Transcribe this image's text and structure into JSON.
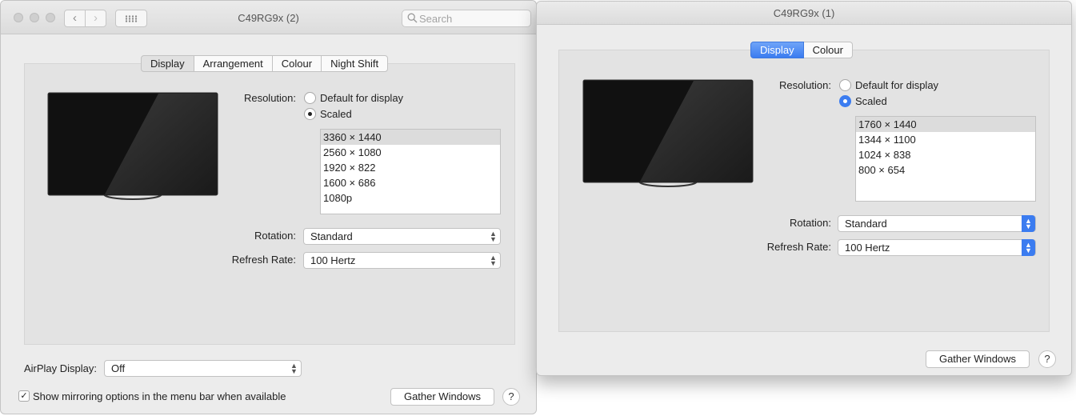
{
  "left_window": {
    "title": "C49RG9x (2)",
    "search_placeholder": "Search",
    "nav": {
      "back_glyph": "‹",
      "forward_glyph": "›"
    },
    "tabs": [
      "Display",
      "Arrangement",
      "Colour",
      "Night Shift"
    ],
    "selected_tab": "Display",
    "resolution": {
      "label": "Resolution:",
      "option_default": "Default for display",
      "option_scaled": "Scaled",
      "selected": "Scaled",
      "list": [
        "3360 × 1440",
        "2560 × 1080",
        "1920 × 822",
        "1600 × 686",
        "1080p"
      ],
      "list_selected": "3360 × 1440"
    },
    "rotation": {
      "label": "Rotation:",
      "value": "Standard"
    },
    "refresh": {
      "label": "Refresh Rate:",
      "value": "100 Hertz"
    },
    "airplay": {
      "label": "AirPlay Display:",
      "value": "Off"
    },
    "mirroring": {
      "label": "Show mirroring options in the menu bar when available",
      "checked": true,
      "check_glyph": "✓"
    },
    "gather_label": "Gather Windows",
    "help_glyph": "?"
  },
  "right_window": {
    "title": "C49RG9x (1)",
    "tabs": [
      "Display",
      "Colour"
    ],
    "selected_tab": "Display",
    "resolution": {
      "label": "Resolution:",
      "option_default": "Default for display",
      "option_scaled": "Scaled",
      "selected": "Scaled",
      "list": [
        "1760 × 1440",
        "1344 × 1100",
        "1024 × 838",
        "800 × 654"
      ],
      "list_selected": "1760 × 1440"
    },
    "rotation": {
      "label": "Rotation:",
      "value": "Standard"
    },
    "refresh": {
      "label": "Refresh Rate:",
      "value": "100 Hertz"
    },
    "gather_label": "Gather Windows",
    "help_glyph": "?"
  },
  "colors": {
    "accent": "#3b7cf0",
    "window_bg": "#ececec",
    "panel_bg": "#e3e3e3"
  }
}
